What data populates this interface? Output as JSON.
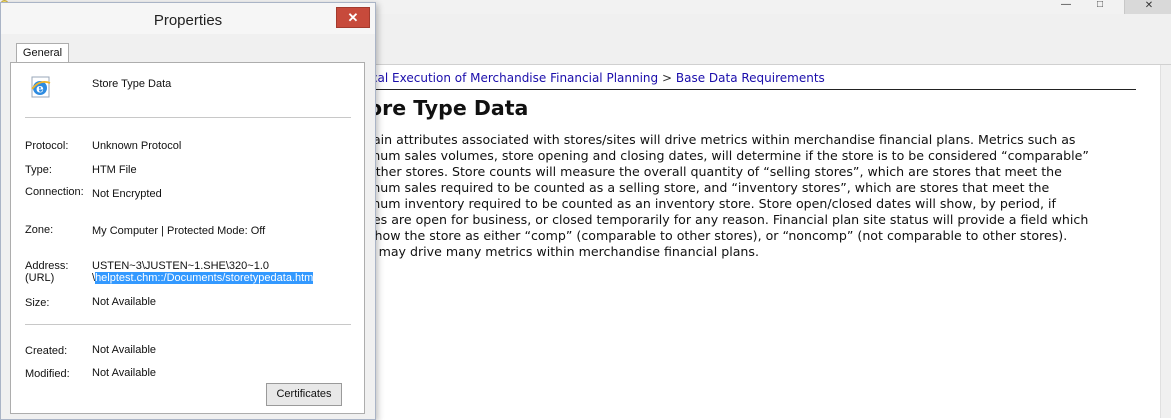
{
  "background_window": {
    "minimize_glyph": "—",
    "maximize_glyph": "□",
    "close_glyph": "✕",
    "breadcrumb": {
      "link1": "nical Execution of Merchandise Financial Planning",
      "separator": ">",
      "link2": "Base Data Requirements"
    },
    "heading": "ore Type Data",
    "body_lines": [
      "tain attributes associated with stores/sites will drive metrics within merchandise financial plans. Metrics such as",
      "mum sales volumes, store opening and closing dates, will determine if the store is to be considered “comparable”",
      "other stores. Store counts will measure the overall quantity of “selling stores”, which are stores that meet the",
      "mum sales required to be counted as a selling store, and “inventory stores”, which are stores that meet the",
      "mum inventory required to be counted as an inventory store. Store open/closed dates will show, by period, if",
      "res are open for business, or closed temporarily for any reason. Financial plan site status will provide a field which",
      "show the store as either “comp” (comparable to other stores), or “noncomp” (not comparable to other stores).",
      "s may drive many metrics within merchandise financial plans."
    ]
  },
  "dialog": {
    "title": "Properties",
    "close_glyph": "✕",
    "tab_label": "General",
    "file_name": "Store Type Data",
    "icon": "internet-explorer-icon",
    "fields": {
      "protocol_label": "Protocol:",
      "protocol_value": "Unknown Protocol",
      "type_label": "Type:",
      "type_value": "HTM File",
      "connection_label": "Connection:",
      "connection_value": "Not Encrypted",
      "zone_label": "Zone:",
      "zone_value": "My Computer | Protected Mode: Off",
      "address_label": "Address:",
      "url_label": "(URL)",
      "address_line1": "USTEN~3\\JUSTEN~1.SHE\\320~1.0",
      "address_line2_prefix": "\\",
      "address_line2_selected": "helptest.chm::/Documents/storetypedata.htm",
      "size_label": "Size:",
      "size_value": "Not Available",
      "created_label": "Created:",
      "created_value": "Not Available",
      "modified_label": "Modified:",
      "modified_value": "Not Available"
    },
    "certificates_button": "Certificates"
  },
  "colors": {
    "link": "#1a0dab",
    "close_button": "#c74a3b",
    "selection": "#3399ff"
  }
}
